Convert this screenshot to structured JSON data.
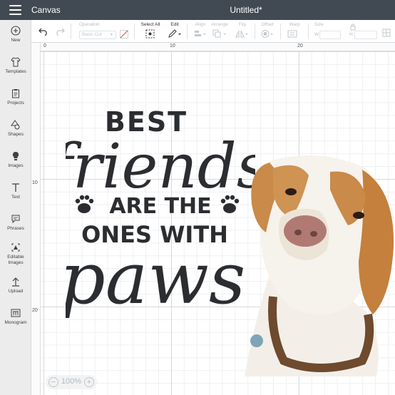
{
  "header": {
    "app_title": "Canvas",
    "doc_title": "Untitled*"
  },
  "toolbar": {
    "operation_label": "Operation",
    "operation_value": "Basic Cut",
    "select_all_label": "Select All",
    "edit_label": "Edit",
    "align_label": "Align",
    "arrange_label": "Arrange",
    "flip_label": "Flip",
    "offset_label": "Offset",
    "warp_label": "Warp",
    "size_label": "Size",
    "width_label": "W",
    "height_label": "H"
  },
  "sidebar": {
    "items": [
      {
        "label": "New",
        "icon": "plus-circle-icon"
      },
      {
        "label": "Templates",
        "icon": "shirt-icon"
      },
      {
        "label": "Projects",
        "icon": "clipboard-icon"
      },
      {
        "label": "Shapes",
        "icon": "shapes-icon"
      },
      {
        "label": "Images",
        "icon": "lightbulb-icon"
      },
      {
        "label": "Text",
        "icon": "text-icon"
      },
      {
        "label": "Phrases",
        "icon": "speech-bubble-icon"
      },
      {
        "label": "Editable Images",
        "icon": "editable-image-icon"
      },
      {
        "label": "Upload",
        "icon": "upload-icon"
      },
      {
        "label": "Monogram",
        "icon": "monogram-icon"
      }
    ]
  },
  "ruler": {
    "top": [
      "0",
      "10",
      "20"
    ],
    "left": [
      "10",
      "20"
    ]
  },
  "design": {
    "line1": "BEST",
    "line2": "friends",
    "line3": "ARE THE",
    "line4": "ONES WITH",
    "line5": "paws"
  },
  "zoom": {
    "value": "100%",
    "minus": "−",
    "plus": "+"
  },
  "colors": {
    "topbar": "#414a53",
    "sidebar": "#ececec",
    "ink": "#2b2d30"
  }
}
